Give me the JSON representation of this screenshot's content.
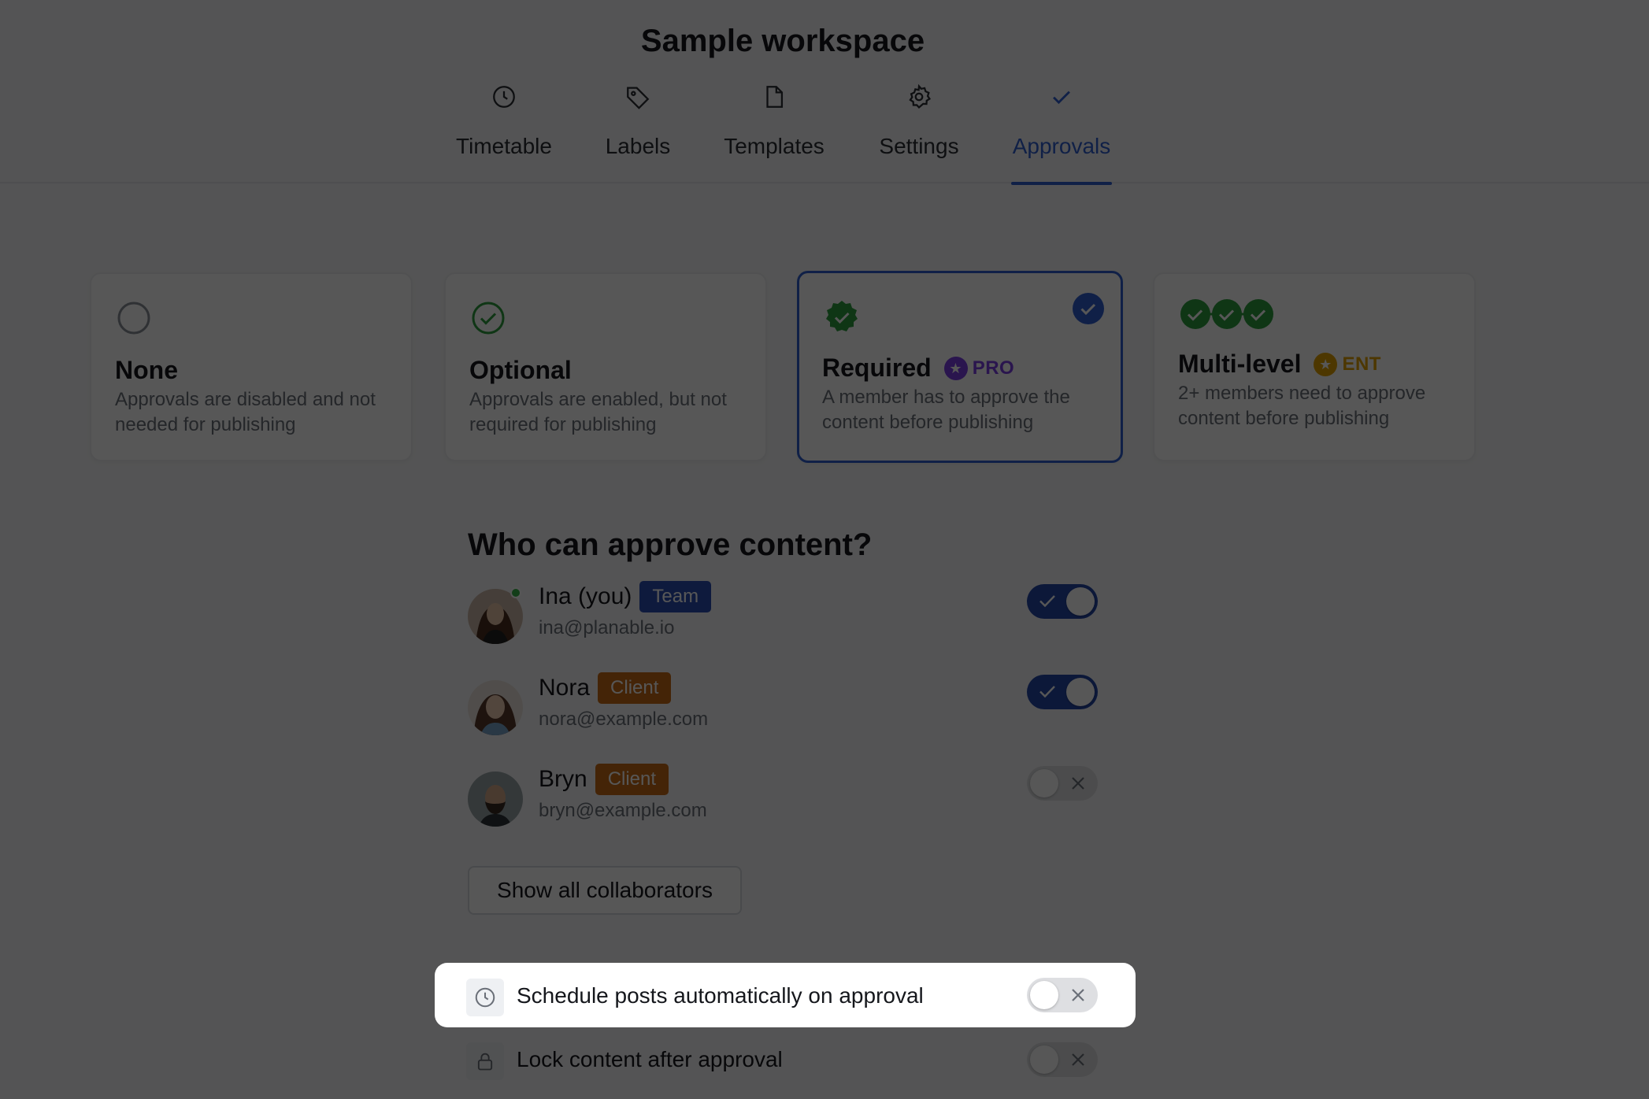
{
  "workspace": {
    "title": "Sample workspace"
  },
  "tabs": [
    {
      "label": "Timetable",
      "icon": "clock-icon"
    },
    {
      "label": "Labels",
      "icon": "tag-icon"
    },
    {
      "label": "Templates",
      "icon": "file-icon"
    },
    {
      "label": "Settings",
      "icon": "gear-icon"
    },
    {
      "label": "Approvals",
      "icon": "check-icon",
      "active": true
    }
  ],
  "approval_modes": [
    {
      "title": "None",
      "description": "Approvals are disabled and not needed for publishing",
      "selected": false
    },
    {
      "title": "Optional",
      "description": "Approvals are enabled, but not required for publishing",
      "selected": false
    },
    {
      "title": "Required",
      "badge": "PRO",
      "description": "A member has to approve the content before publishing",
      "selected": true
    },
    {
      "title": "Multi-level",
      "badge": "ENT",
      "description": "2+ members need to approve content before publishing",
      "selected": false
    }
  ],
  "approvers": {
    "title": "Who can approve content?",
    "members": [
      {
        "name": "Ina (you)",
        "role": "Team",
        "email": "ina@planable.io",
        "enabled": true
      },
      {
        "name": "Nora",
        "role": "Client",
        "email": "nora@example.com",
        "enabled": true
      },
      {
        "name": "Bryn",
        "role": "Client",
        "email": "bryn@example.com",
        "enabled": false
      }
    ],
    "show_all_label": "Show all collaborators"
  },
  "settings": [
    {
      "label": "Schedule posts automatically on approval",
      "icon": "clock-icon",
      "enabled": false
    },
    {
      "label": "Lock content after approval",
      "icon": "lock-icon",
      "enabled": false
    }
  ],
  "colors": {
    "accent": "#2f5fd0",
    "pro": "#7b3fe4",
    "ent": "#e0a100",
    "green": "#2e9e3e",
    "client": "#c76a16",
    "team": "#2b4eb3"
  }
}
